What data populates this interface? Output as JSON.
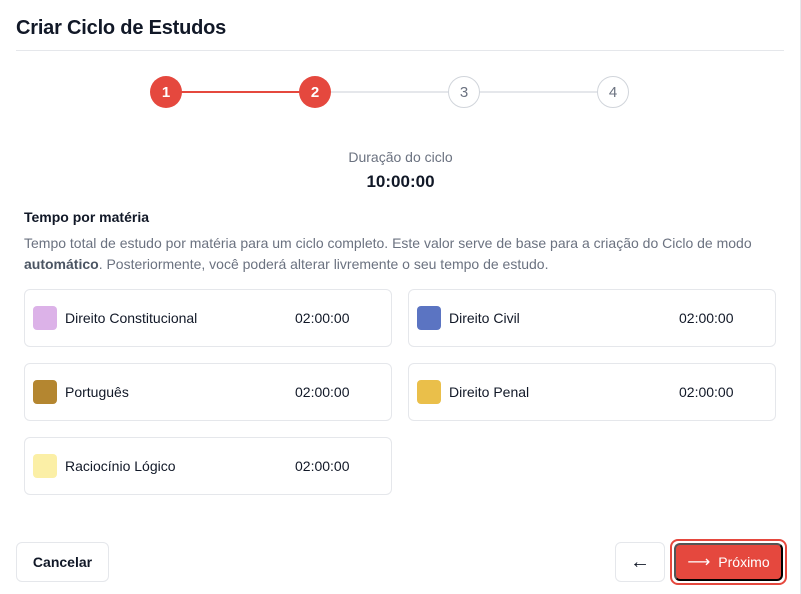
{
  "dialog": {
    "title": "Criar Ciclo de Estudos"
  },
  "stepper": {
    "steps": [
      {
        "label": "1",
        "state": "active"
      },
      {
        "label": "2",
        "state": "active"
      },
      {
        "label": "3",
        "state": "inactive"
      },
      {
        "label": "4",
        "state": "inactive"
      }
    ],
    "active_color": "#e5483e",
    "inactive_color": "#d1d5db"
  },
  "duration": {
    "label": "Duração do ciclo",
    "value": "10:00:00"
  },
  "section": {
    "heading": "Tempo por matéria",
    "desc_part1": "Tempo total de estudo por matéria para um ciclo completo. Este valor serve de base para a criação do Ciclo de modo ",
    "desc_bold": "automático",
    "desc_part2": ". Posteriormente, você poderá alterar livremente o seu tempo de estudo."
  },
  "subjects": [
    {
      "name": "Direito Constitucional",
      "time": "02:00:00",
      "color": "#dcb2e8"
    },
    {
      "name": "Direito Civil",
      "time": "02:00:00",
      "color": "#5b74c2"
    },
    {
      "name": "Português",
      "time": "02:00:00",
      "color": "#b48630"
    },
    {
      "name": "Direito Penal",
      "time": "02:00:00",
      "color": "#eabf4a"
    },
    {
      "name": "Raciocínio Lógico",
      "time": "02:00:00",
      "color": "#fbefa6"
    }
  ],
  "footer": {
    "cancel_label": "Cancelar",
    "back_icon": "arrow-left-icon",
    "back_glyph": "←",
    "next_icon": "arrow-right-icon",
    "next_glyph": "⟶",
    "next_label": "Próximo"
  },
  "colors": {
    "accent": "#e5483e"
  }
}
